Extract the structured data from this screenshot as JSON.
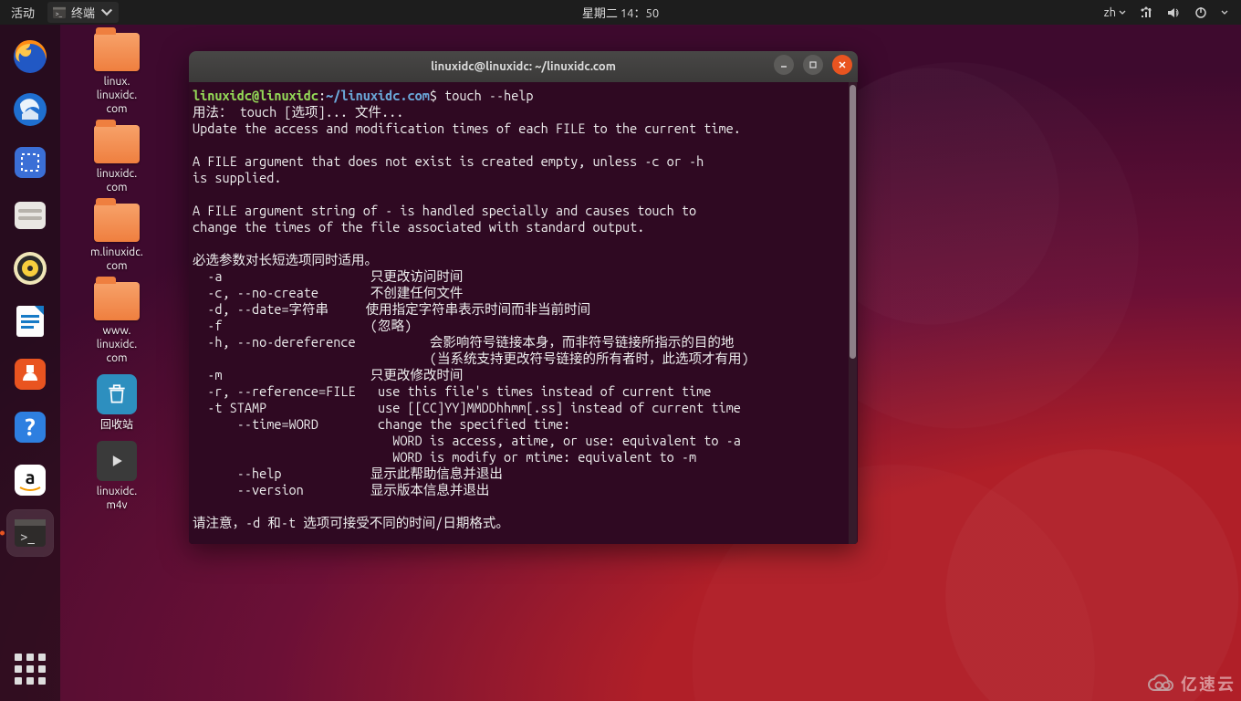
{
  "topbar": {
    "activities": "活动",
    "app_label": "终端",
    "clock": "星期二 14：50",
    "lang": "zh"
  },
  "desktop": {
    "icons": [
      {
        "type": "folder",
        "label": "linux.\nlinuxidc.\ncom"
      },
      {
        "type": "folder",
        "label": "linuxidc.\ncom"
      },
      {
        "type": "folder",
        "label": "m.linuxidc.\ncom"
      },
      {
        "type": "folder",
        "label": "www.\nlinuxidc.\ncom"
      },
      {
        "type": "trash",
        "label": "回收站"
      },
      {
        "type": "video",
        "label": "linuxidc.\nm4v"
      }
    ]
  },
  "terminal": {
    "title": "linuxidc@linuxidc: ~/linuxidc.com",
    "prompt": {
      "user_host": "linuxidc@linuxidc",
      "path": "~/linuxidc.com",
      "command": "touch --help"
    },
    "output_lines": [
      "用法： touch [选项]... 文件...",
      "Update the access and modification times of each FILE to the current time.",
      "",
      "A FILE argument that does not exist is created empty, unless -c or -h",
      "is supplied.",
      "",
      "A FILE argument string of - is handled specially and causes touch to",
      "change the times of the file associated with standard output.",
      "",
      "必选参数对长短选项同时适用。",
      "  -a                    只更改访问时间",
      "  -c, --no-create       不创建任何文件",
      "  -d, --date=字符串     使用指定字符串表示时间而非当前时间",
      "  -f                    (忽略)",
      "  -h, --no-dereference          会影响符号链接本身，而非符号链接所指示的目的地",
      "                                (当系统支持更改符号链接的所有者时，此选项才有用)",
      "  -m                    只更改修改时间",
      "  -r, --reference=FILE   use this file's times instead of current time",
      "  -t STAMP               use [[CC]YY]MMDDhhmm[.ss] instead of current time",
      "      --time=WORD        change the specified time:",
      "                           WORD is access, atime, or use: equivalent to -a",
      "                           WORD is modify or mtime: equivalent to -m",
      "      --help            显示此帮助信息并退出",
      "      --version         显示版本信息并退出",
      "",
      "请注意，-d 和-t 选项可接受不同的时间/日期格式。"
    ]
  },
  "watermark": "亿速云"
}
